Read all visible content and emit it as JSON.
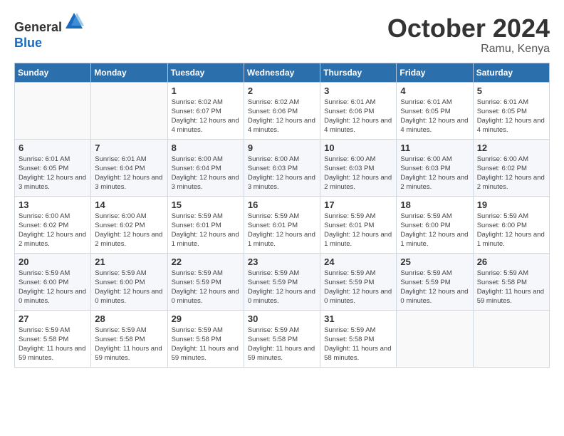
{
  "header": {
    "logo_line1": "General",
    "logo_line2": "Blue",
    "month": "October 2024",
    "location": "Ramu, Kenya"
  },
  "days_of_week": [
    "Sunday",
    "Monday",
    "Tuesday",
    "Wednesday",
    "Thursday",
    "Friday",
    "Saturday"
  ],
  "weeks": [
    [
      {
        "day": "",
        "detail": ""
      },
      {
        "day": "",
        "detail": ""
      },
      {
        "day": "1",
        "detail": "Sunrise: 6:02 AM\nSunset: 6:07 PM\nDaylight: 12 hours and 4 minutes."
      },
      {
        "day": "2",
        "detail": "Sunrise: 6:02 AM\nSunset: 6:06 PM\nDaylight: 12 hours and 4 minutes."
      },
      {
        "day": "3",
        "detail": "Sunrise: 6:01 AM\nSunset: 6:06 PM\nDaylight: 12 hours and 4 minutes."
      },
      {
        "day": "4",
        "detail": "Sunrise: 6:01 AM\nSunset: 6:05 PM\nDaylight: 12 hours and 4 minutes."
      },
      {
        "day": "5",
        "detail": "Sunrise: 6:01 AM\nSunset: 6:05 PM\nDaylight: 12 hours and 4 minutes."
      }
    ],
    [
      {
        "day": "6",
        "detail": "Sunrise: 6:01 AM\nSunset: 6:05 PM\nDaylight: 12 hours and 3 minutes."
      },
      {
        "day": "7",
        "detail": "Sunrise: 6:01 AM\nSunset: 6:04 PM\nDaylight: 12 hours and 3 minutes."
      },
      {
        "day": "8",
        "detail": "Sunrise: 6:00 AM\nSunset: 6:04 PM\nDaylight: 12 hours and 3 minutes."
      },
      {
        "day": "9",
        "detail": "Sunrise: 6:00 AM\nSunset: 6:03 PM\nDaylight: 12 hours and 3 minutes."
      },
      {
        "day": "10",
        "detail": "Sunrise: 6:00 AM\nSunset: 6:03 PM\nDaylight: 12 hours and 2 minutes."
      },
      {
        "day": "11",
        "detail": "Sunrise: 6:00 AM\nSunset: 6:03 PM\nDaylight: 12 hours and 2 minutes."
      },
      {
        "day": "12",
        "detail": "Sunrise: 6:00 AM\nSunset: 6:02 PM\nDaylight: 12 hours and 2 minutes."
      }
    ],
    [
      {
        "day": "13",
        "detail": "Sunrise: 6:00 AM\nSunset: 6:02 PM\nDaylight: 12 hours and 2 minutes."
      },
      {
        "day": "14",
        "detail": "Sunrise: 6:00 AM\nSunset: 6:02 PM\nDaylight: 12 hours and 2 minutes."
      },
      {
        "day": "15",
        "detail": "Sunrise: 5:59 AM\nSunset: 6:01 PM\nDaylight: 12 hours and 1 minute."
      },
      {
        "day": "16",
        "detail": "Sunrise: 5:59 AM\nSunset: 6:01 PM\nDaylight: 12 hours and 1 minute."
      },
      {
        "day": "17",
        "detail": "Sunrise: 5:59 AM\nSunset: 6:01 PM\nDaylight: 12 hours and 1 minute."
      },
      {
        "day": "18",
        "detail": "Sunrise: 5:59 AM\nSunset: 6:00 PM\nDaylight: 12 hours and 1 minute."
      },
      {
        "day": "19",
        "detail": "Sunrise: 5:59 AM\nSunset: 6:00 PM\nDaylight: 12 hours and 1 minute."
      }
    ],
    [
      {
        "day": "20",
        "detail": "Sunrise: 5:59 AM\nSunset: 6:00 PM\nDaylight: 12 hours and 0 minutes."
      },
      {
        "day": "21",
        "detail": "Sunrise: 5:59 AM\nSunset: 6:00 PM\nDaylight: 12 hours and 0 minutes."
      },
      {
        "day": "22",
        "detail": "Sunrise: 5:59 AM\nSunset: 5:59 PM\nDaylight: 12 hours and 0 minutes."
      },
      {
        "day": "23",
        "detail": "Sunrise: 5:59 AM\nSunset: 5:59 PM\nDaylight: 12 hours and 0 minutes."
      },
      {
        "day": "24",
        "detail": "Sunrise: 5:59 AM\nSunset: 5:59 PM\nDaylight: 12 hours and 0 minutes."
      },
      {
        "day": "25",
        "detail": "Sunrise: 5:59 AM\nSunset: 5:59 PM\nDaylight: 12 hours and 0 minutes."
      },
      {
        "day": "26",
        "detail": "Sunrise: 5:59 AM\nSunset: 5:58 PM\nDaylight: 11 hours and 59 minutes."
      }
    ],
    [
      {
        "day": "27",
        "detail": "Sunrise: 5:59 AM\nSunset: 5:58 PM\nDaylight: 11 hours and 59 minutes."
      },
      {
        "day": "28",
        "detail": "Sunrise: 5:59 AM\nSunset: 5:58 PM\nDaylight: 11 hours and 59 minutes."
      },
      {
        "day": "29",
        "detail": "Sunrise: 5:59 AM\nSunset: 5:58 PM\nDaylight: 11 hours and 59 minutes."
      },
      {
        "day": "30",
        "detail": "Sunrise: 5:59 AM\nSunset: 5:58 PM\nDaylight: 11 hours and 59 minutes."
      },
      {
        "day": "31",
        "detail": "Sunrise: 5:59 AM\nSunset: 5:58 PM\nDaylight: 11 hours and 58 minutes."
      },
      {
        "day": "",
        "detail": ""
      },
      {
        "day": "",
        "detail": ""
      }
    ]
  ]
}
